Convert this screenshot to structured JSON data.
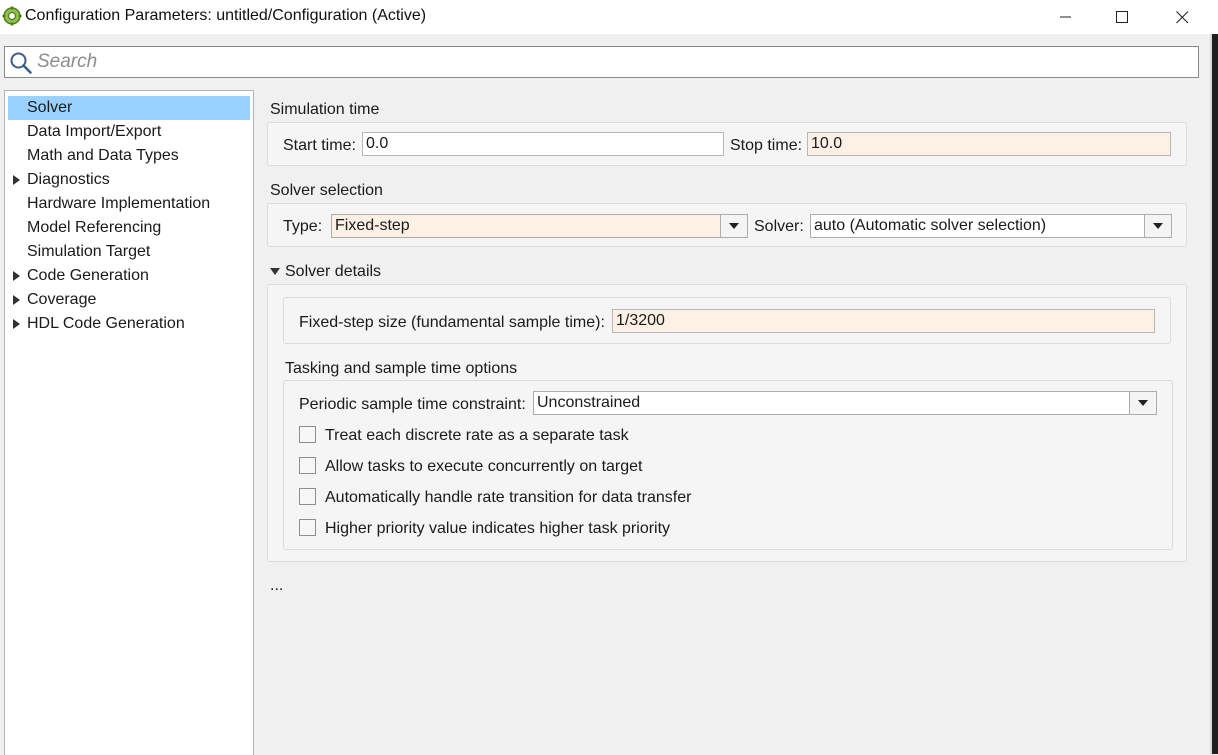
{
  "window": {
    "title": "Configuration Parameters: untitled/Configuration (Active)"
  },
  "search": {
    "placeholder": "Search"
  },
  "sidebar": {
    "items": [
      {
        "label": "Solver",
        "selected": true,
        "expandable": false
      },
      {
        "label": "Data Import/Export",
        "expandable": false
      },
      {
        "label": "Math and Data Types",
        "expandable": false
      },
      {
        "label": "Diagnostics",
        "expandable": true
      },
      {
        "label": "Hardware Implementation",
        "expandable": false
      },
      {
        "label": "Model Referencing",
        "expandable": false
      },
      {
        "label": "Simulation Target",
        "expandable": false
      },
      {
        "label": "Code Generation",
        "expandable": true
      },
      {
        "label": "Coverage",
        "expandable": true
      },
      {
        "label": "HDL Code Generation",
        "expandable": true
      }
    ]
  },
  "simulation_time": {
    "title": "Simulation time",
    "start_label": "Start time:",
    "start_value": "0.0",
    "stop_label": "Stop time:",
    "stop_value": "10.0"
  },
  "solver_selection": {
    "title": "Solver selection",
    "type_label": "Type:",
    "type_value": "Fixed-step",
    "solver_label": "Solver:",
    "solver_value": "auto (Automatic solver selection)"
  },
  "solver_details": {
    "title": "Solver details",
    "step_size_label": "Fixed-step size (fundamental sample time):",
    "step_size_value": "1/3200"
  },
  "tasking": {
    "title": "Tasking and sample time options",
    "constraint_label": "Periodic sample time constraint:",
    "constraint_value": "Unconstrained",
    "checkboxes": [
      {
        "label": "Treat each discrete rate as a separate task",
        "checked": false
      },
      {
        "label": "Allow tasks to execute concurrently on target",
        "checked": false
      },
      {
        "label": "Automatically handle rate transition for data transfer",
        "checked": false
      },
      {
        "label": "Higher priority value indicates higher task priority",
        "checked": false
      }
    ]
  },
  "more": "...",
  "colors": {
    "selection": "#99d1ff",
    "modified_field": "#fdf0e5"
  }
}
